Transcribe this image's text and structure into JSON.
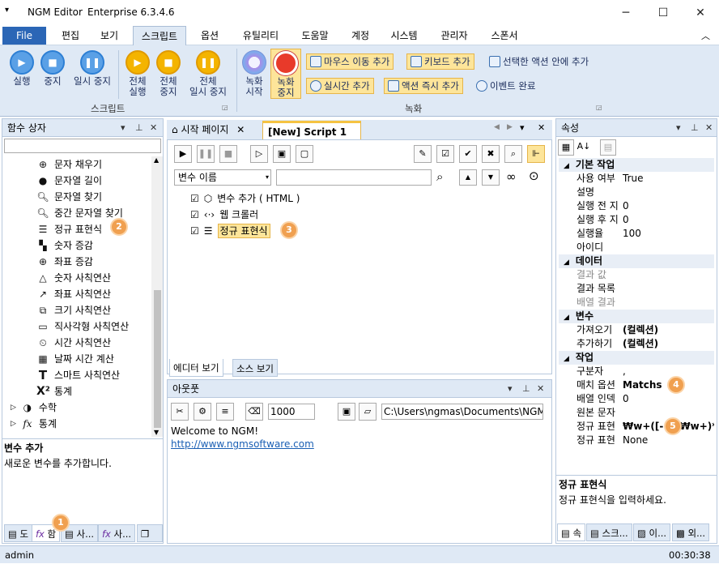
{
  "window": {
    "title": "NGM Editor",
    "edition": "Enterprise 6.3.4.6",
    "minimize": "─",
    "maximize": "☐",
    "close": "✕"
  },
  "menu": {
    "file": "File",
    "tabs": [
      "편집",
      "보기",
      "스크립트",
      "옵션",
      "유틸리티",
      "도움말",
      "계정",
      "시스템",
      "관리자",
      "스폰서"
    ],
    "active": "스크립트"
  },
  "ribbon": {
    "script_group": "스크립트",
    "record_group": "녹화",
    "run": "실행",
    "stop": "중지",
    "pause": "일시 중지",
    "all_run": [
      "전체",
      "실행"
    ],
    "all_stop": [
      "전체",
      "중지"
    ],
    "all_pause": [
      "전체",
      "일시 중지"
    ],
    "rec_start": [
      "녹화",
      "시작"
    ],
    "rec_stop": [
      "녹화",
      "중지"
    ],
    "mouse_add": "마우스 이동 추가",
    "key_add": "키보드 추가",
    "in_action": "선택한 액션 안에 추가",
    "realtime_add": "실시간 추가",
    "action_now": "액션 즉시 추가",
    "event_done": "이벤트 완료"
  },
  "left_panel": {
    "title": "함수 상자",
    "items": [
      "문자 채우기",
      "문자열 길이",
      "문자열 찾기",
      "중간 문자열 찾기",
      "정규 표현식",
      "숫자 증감",
      "좌표 증감",
      "숫자 사칙연산",
      "좌표 사칙연산",
      "크기 사칙연산",
      "직사각형 사칙연산",
      "시간 사칙연산",
      "날짜 시간 계산",
      "스마트 사칙연산",
      "통계"
    ],
    "groups": [
      "수학",
      "통계"
    ],
    "info_title": "변수 추가",
    "info_desc": "새로운 변수를 추가합니다.",
    "bottom_tabs": [
      "도",
      "함",
      "사...",
      "사...",
      "즐"
    ]
  },
  "doc_tabs": {
    "start": "시작 페이지",
    "script": "[New] Script 1"
  },
  "script": {
    "var_select": "변수 이름",
    "steps": [
      "변수 추가 ( HTML )",
      "웹 크롤러",
      "정규 표현식"
    ],
    "view_tabs": [
      "에디터 보기",
      "소스 보기"
    ]
  },
  "output": {
    "title": "아웃풋",
    "count": "1000",
    "path": "C:\\Users\\ngmas\\Documents\\NGM6\\",
    "lines": [
      "Welcome to NGM!",
      "http://www.ngmsoftware.com"
    ]
  },
  "props": {
    "title": "속성",
    "cats": [
      "기본 작업",
      "데이터",
      "변수",
      "작업"
    ],
    "basic": [
      [
        "사용 여부",
        "True"
      ],
      [
        "설명",
        ""
      ],
      [
        "실행 전 지",
        "0"
      ],
      [
        "실행 후 지",
        "0"
      ],
      [
        "실행율",
        "100"
      ],
      [
        "아이디",
        ""
      ]
    ],
    "data": [
      [
        "결과 값",
        ""
      ],
      [
        "결과 목록",
        ""
      ],
      [
        "배열 결과",
        ""
      ]
    ],
    "var": [
      [
        "가져오기",
        "(컬렉션)"
      ],
      [
        "추가하기",
        "(컬렉션)"
      ]
    ],
    "work": [
      [
        "구분자",
        ","
      ],
      [
        "매치 옵션",
        "Matchs"
      ],
      [
        "배열 인덱",
        "0"
      ],
      [
        "원본 문자",
        ""
      ],
      [
        "정규 표현",
        "₩w+([-+.]₩w+)*"
      ],
      [
        "정규 표현",
        "None"
      ]
    ],
    "info_title": "정규 표현식",
    "info_desc": "정규 표현식을 입력하세요.",
    "bottom_tabs": [
      "속",
      "스크...",
      "이...",
      "외..."
    ]
  },
  "badges": [
    "1",
    "2",
    "3",
    "4",
    "5"
  ],
  "status": {
    "user": "admin",
    "time": "00:30:38"
  }
}
